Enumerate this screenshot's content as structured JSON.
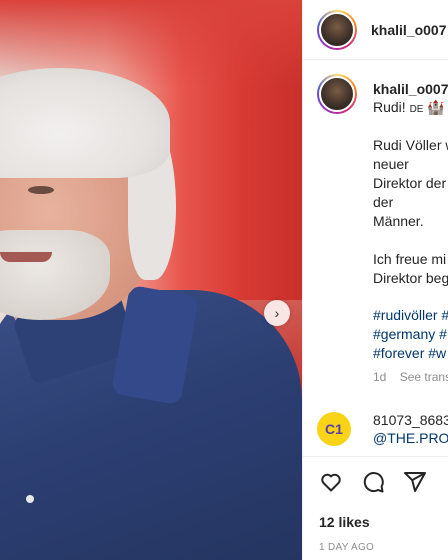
{
  "post": {
    "next_icon": "chevron-right-icon"
  },
  "header": {
    "username": "khalil_o007"
  },
  "caption": {
    "username": "khalil_o007",
    "first_line": "Rudi!",
    "flag": "DE",
    "emoji": "castle",
    "lines": [
      "Rudi Völler w",
      "neuer",
      "Direktor der",
      "der",
      "Männer.",
      "",
      "Ich freue mi",
      "Direktor beg"
    ],
    "hashtags": [
      "#rudivöller #",
      "#germany #",
      "#forever #w"
    ],
    "time": "1d",
    "see_translation": "See trans"
  },
  "comment2": {
    "avatar_label": "C1",
    "username": "81073_8683",
    "mention": "@THE.PROM"
  },
  "actions": {
    "like_icon": "heart-icon",
    "comment_icon": "comment-icon",
    "share_icon": "share-icon"
  },
  "likes": "12 likes",
  "date": "1 DAY AGO"
}
